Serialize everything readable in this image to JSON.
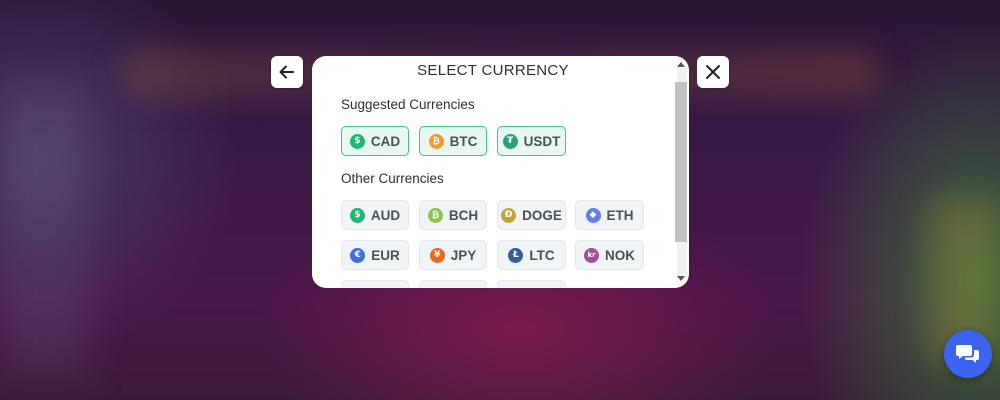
{
  "modal": {
    "title": "SELECT CURRENCY",
    "suggested_label": "Suggested Currencies",
    "other_label": "Other Currencies"
  },
  "suggested": [
    {
      "code": "CAD",
      "icon": "dollar-coin-icon",
      "glyph": "$",
      "color": "#22b573"
    },
    {
      "code": "BTC",
      "icon": "bitcoin-icon",
      "glyph": "₿",
      "color": "#f29a2e"
    },
    {
      "code": "USDT",
      "icon": "tether-icon",
      "glyph": "₮",
      "color": "#26a17b"
    }
  ],
  "other": [
    {
      "code": "AUD",
      "icon": "dollar-coin-icon",
      "glyph": "$",
      "color": "#22b573"
    },
    {
      "code": "BCH",
      "icon": "bitcoin-cash-icon",
      "glyph": "₿",
      "color": "#8dc351"
    },
    {
      "code": "DOGE",
      "icon": "dogecoin-icon",
      "glyph": "Ð",
      "color": "#c2a633"
    },
    {
      "code": "ETH",
      "icon": "ethereum-icon",
      "glyph": "◆",
      "color": "#627eea"
    },
    {
      "code": "EUR",
      "icon": "euro-coin-icon",
      "glyph": "€",
      "color": "#3b6ee8"
    },
    {
      "code": "JPY",
      "icon": "yen-coin-icon",
      "glyph": "¥",
      "color": "#e8691e"
    },
    {
      "code": "LTC",
      "icon": "litecoin-icon",
      "glyph": "Ł",
      "color": "#345d9d"
    },
    {
      "code": "NOK",
      "icon": "krone-coin-icon",
      "glyph": "kr",
      "color": "#a05195"
    }
  ],
  "colors": {
    "accent": "#3cc48a",
    "chat_button": "#3d63f1"
  }
}
